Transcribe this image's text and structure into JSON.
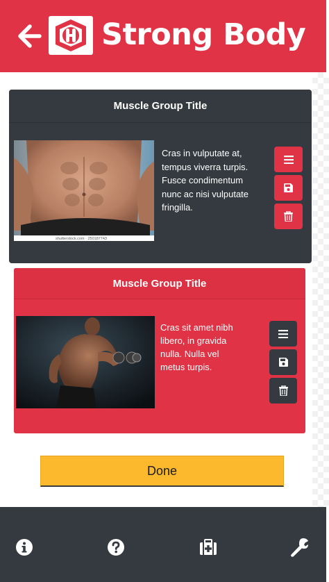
{
  "header": {
    "brand": "Strong Body",
    "back_icon": "back-arrow-icon",
    "logo_icon": "strong-body-logo"
  },
  "cards": [
    {
      "title": "Muscle Group Title",
      "description": "Cras in vulputate at, tempus viverra turpis. Fusce condimentum nunc ac nisi vulputate fringilla.",
      "image_watermark": "shutterstock.com · 250187743",
      "theme": "dark",
      "actions": [
        "menu-icon",
        "save-icon",
        "trash-icon"
      ]
    },
    {
      "title": "Muscle Group Title",
      "description": "Cras sit amet nibh libero, in gravida nulla. Nulla vel metus turpis.",
      "theme": "red",
      "actions": [
        "menu-icon",
        "save-icon",
        "trash-icon"
      ]
    }
  ],
  "done_label": "Done",
  "footer": {
    "icons": [
      "info-icon",
      "help-icon",
      "first-aid-icon",
      "wrench-icon"
    ]
  },
  "colors": {
    "brand_red": "#e03345",
    "dark": "#343a40",
    "done_yellow": "#fdb92e"
  }
}
